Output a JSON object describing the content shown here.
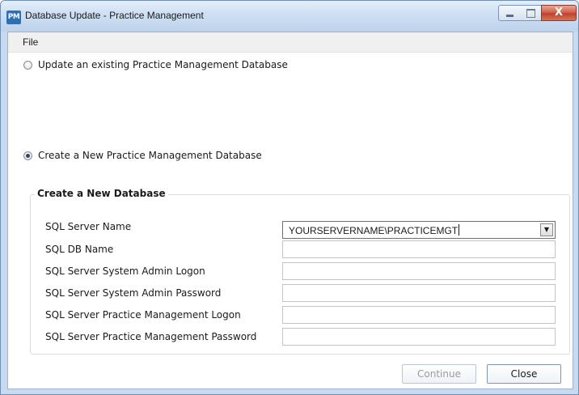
{
  "window": {
    "title": "Database Update - Practice Management",
    "app_icon_text": "PM",
    "close_glyph": "X"
  },
  "menu": {
    "file_label": "File"
  },
  "options": {
    "update_existing_label": "Update an existing Practice Management Database",
    "update_existing_selected": false,
    "create_new_label": "Create a New Practice Management Database",
    "create_new_selected": true
  },
  "group": {
    "title": "Create a New Database",
    "fields": {
      "server_name": {
        "label": "SQL Server Name",
        "value": "YOURSERVERNAME\\PRACTICEMGT"
      },
      "db_name": {
        "label": "SQL DB Name",
        "value": ""
      },
      "admin_logon": {
        "label": "SQL Server System Admin Logon",
        "value": ""
      },
      "admin_password": {
        "label": "SQL Server System Admin Password",
        "value": ""
      },
      "pm_logon": {
        "label": "SQL Server Practice Management Logon",
        "value": ""
      },
      "pm_password": {
        "label": "SQL Server Practice Management Password",
        "value": ""
      }
    }
  },
  "buttons": {
    "continue_label": "Continue",
    "continue_enabled": false,
    "close_label": "Close"
  },
  "icons": {
    "app": "pm-app-icon",
    "minimize": "minimize-icon",
    "maximize": "maximize-icon",
    "close": "close-icon",
    "dropdown": "chevron-down-icon"
  },
  "colors": {
    "title_gradient_top": "#e4eefa",
    "title_gradient_bottom": "#bdd2ec",
    "close_button_red": "#c2412a",
    "app_icon_blue": "#2f6fb7",
    "disabled_text": "#9b9b9b"
  }
}
